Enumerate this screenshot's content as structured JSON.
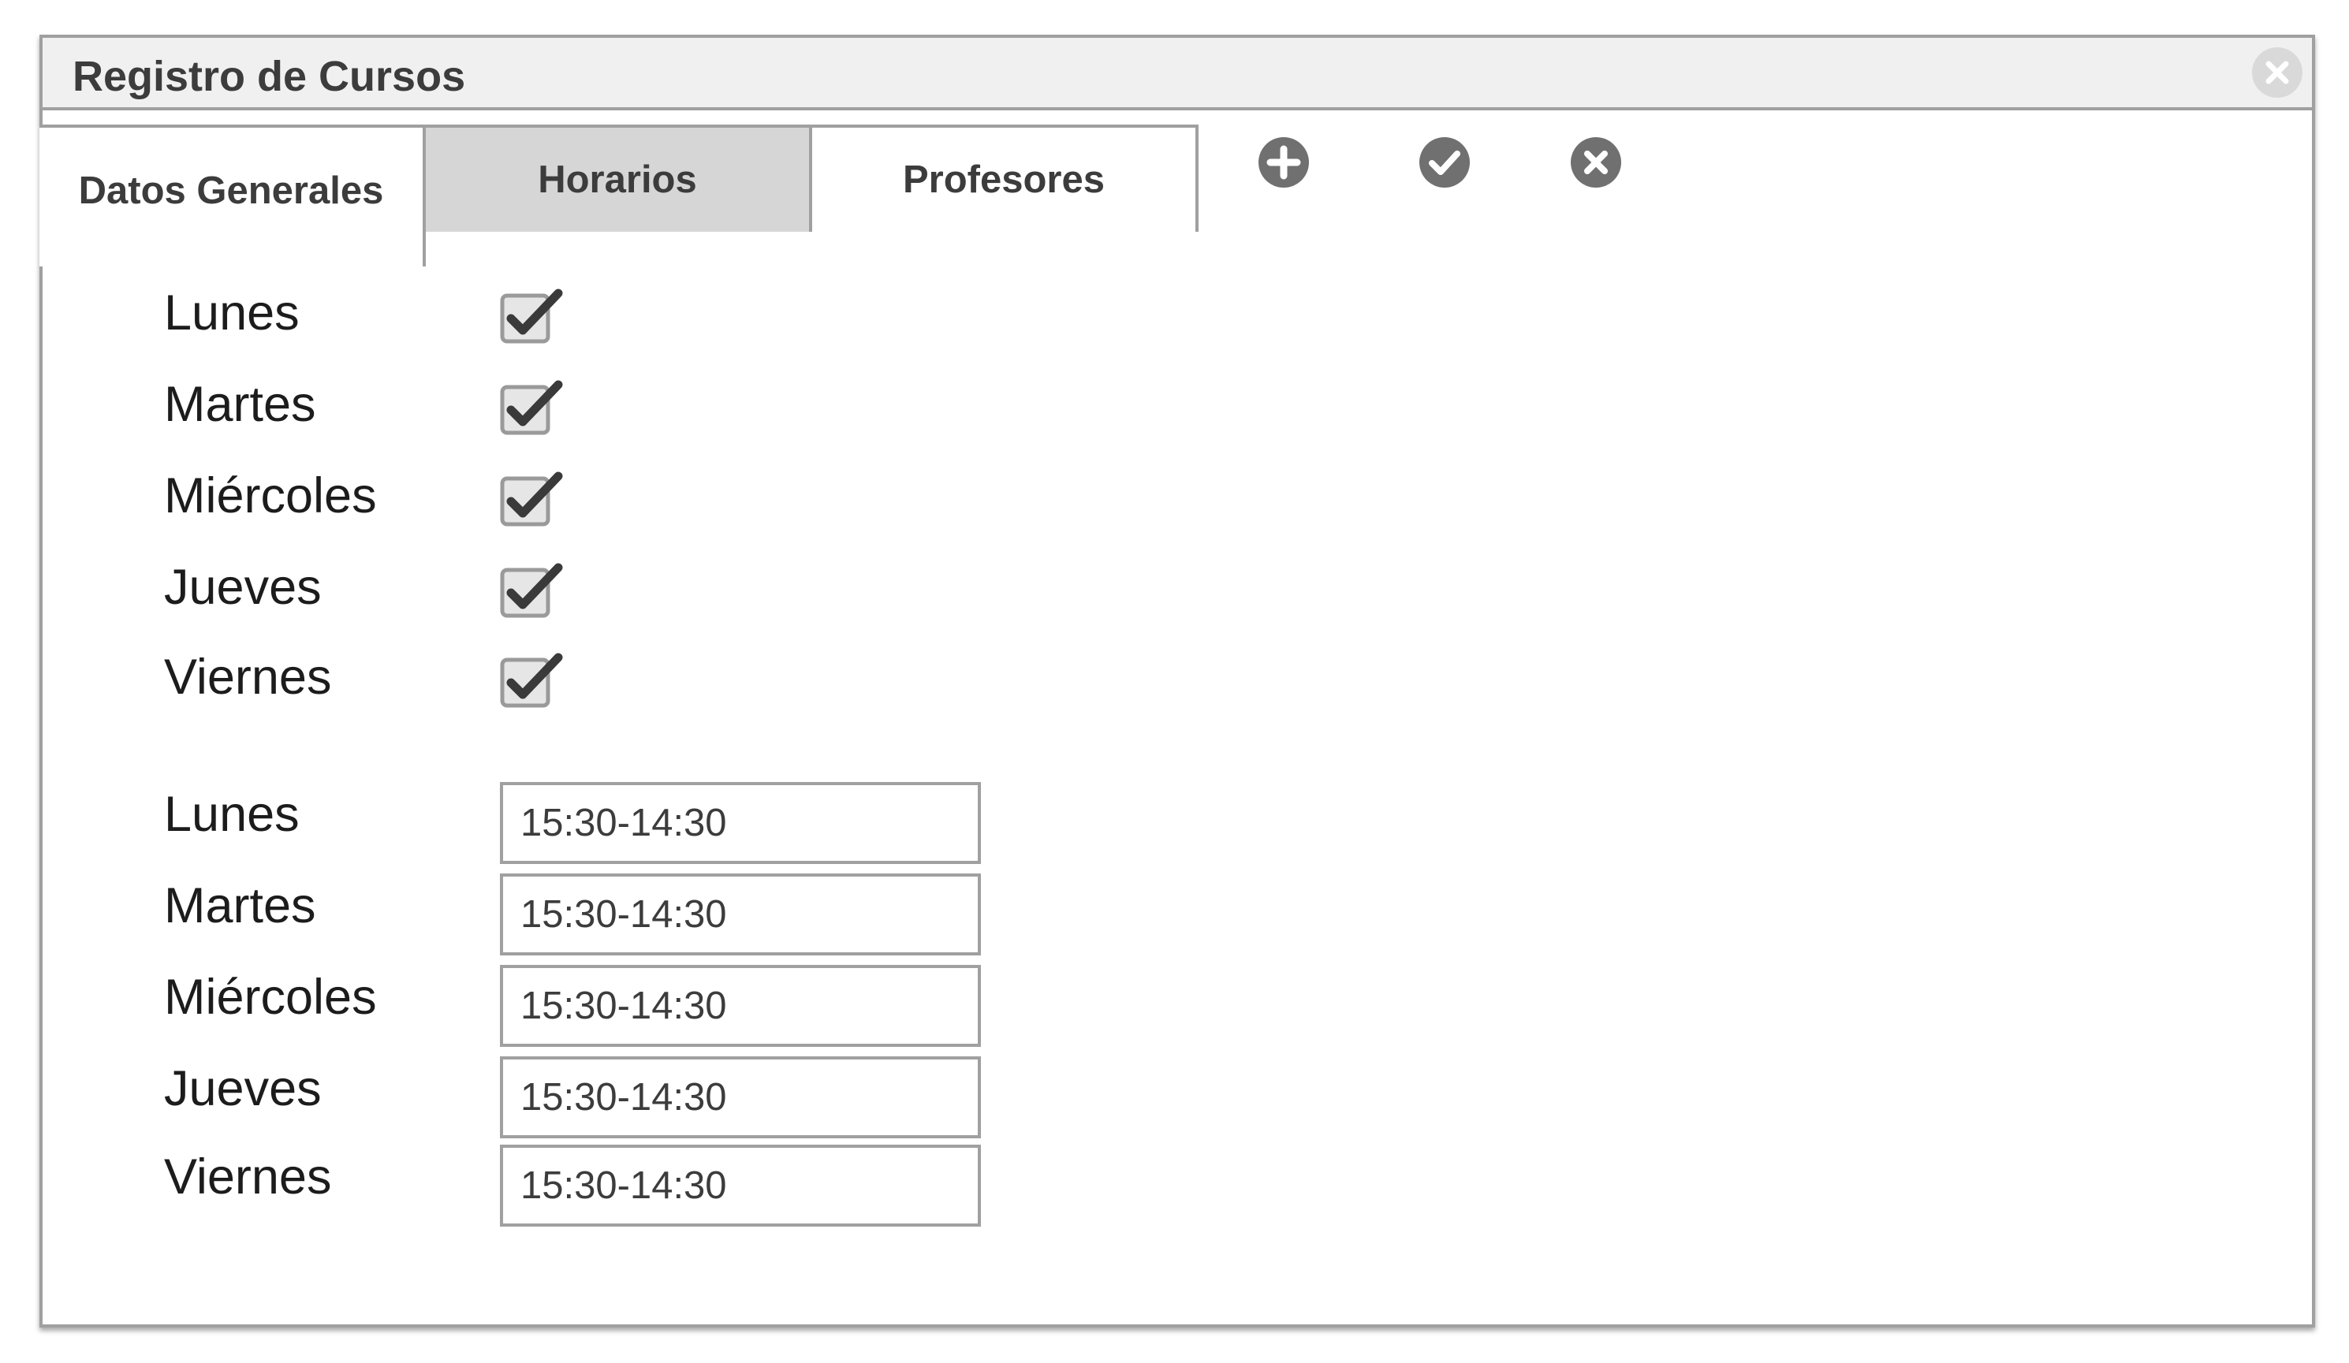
{
  "window": {
    "title": "Registro de Cursos",
    "close_icon": "close-icon"
  },
  "tabs": [
    {
      "label": "Datos Generales",
      "state": "active"
    },
    {
      "label": "Horarios",
      "state": "inactive"
    },
    {
      "label": "Profesores",
      "state": "normal"
    }
  ],
  "toolbar": {
    "icons": [
      "add-icon",
      "confirm-icon",
      "cancel-icon"
    ]
  },
  "days_checked": [
    {
      "label": "Lunes",
      "checked": true
    },
    {
      "label": "Martes",
      "checked": true
    },
    {
      "label": "Miércoles",
      "checked": true
    },
    {
      "label": "Jueves",
      "checked": true
    },
    {
      "label": "Viernes",
      "checked": true
    }
  ],
  "schedule": [
    {
      "label": "Lunes",
      "value": "15:30-14:30"
    },
    {
      "label": "Martes",
      "value": "15:30-14:30"
    },
    {
      "label": "Miércoles",
      "value": "15:30-14:30"
    },
    {
      "label": "Jueves",
      "value": "15:30-14:30"
    },
    {
      "label": "Viernes",
      "value": "15:30-14:30"
    }
  ],
  "colors": {
    "border": "#a0a0a0",
    "titlebar": "#f0f0f0",
    "tab_inactive": "#d6d6d6",
    "icon": "#707070",
    "text": "#3c3c3c"
  }
}
